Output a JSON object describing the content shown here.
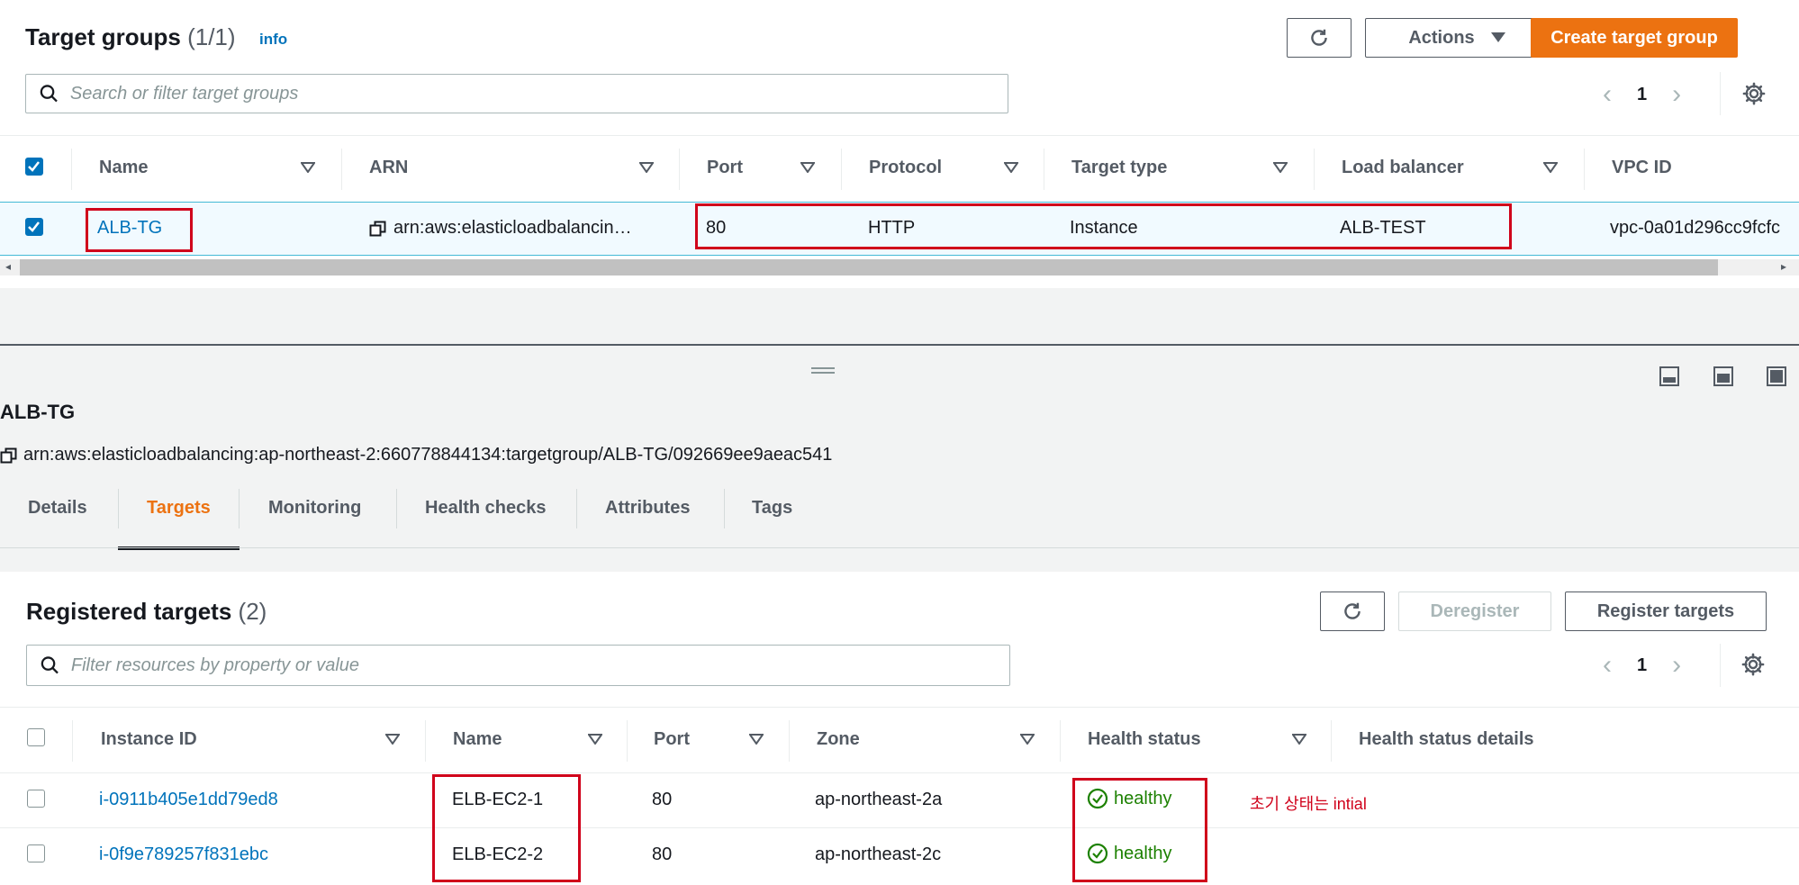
{
  "top": {
    "title": "Target groups",
    "count": "(1/1)",
    "info": "info",
    "actions_label": "Actions",
    "create_label": "Create target group",
    "search_placeholder": "Search or filter target groups",
    "page": "1",
    "columns": [
      "Name",
      "ARN",
      "Port",
      "Protocol",
      "Target type",
      "Load balancer",
      "VPC ID"
    ],
    "row": {
      "name": "ALB-TG",
      "arn": "arn:aws:elasticloadbalancin…",
      "port": "80",
      "protocol": "HTTP",
      "target_type": "Instance",
      "load_balancer": "ALB-TEST",
      "vpc_id": "vpc-0a01d296cc9fcfc"
    }
  },
  "detail": {
    "title": "ALB-TG",
    "arn": "arn:aws:elasticloadbalancing:ap-northeast-2:660778844134:targetgroup/ALB-TG/092669ee9aeac541",
    "tabs": [
      "Details",
      "Targets",
      "Monitoring",
      "Health checks",
      "Attributes",
      "Tags"
    ],
    "active_tab": "Targets"
  },
  "registered": {
    "title": "Registered targets",
    "count": "(2)",
    "deregister_label": "Deregister",
    "register_label": "Register targets",
    "search_placeholder": "Filter resources by property or value",
    "page": "1",
    "columns": [
      "Instance ID",
      "Name",
      "Port",
      "Zone",
      "Health status",
      "Health status details"
    ],
    "rows": [
      {
        "instance_id": "i-0911b405e1dd79ed8",
        "name": "ELB-EC2-1",
        "port": "80",
        "zone": "ap-northeast-2a",
        "health": "healthy"
      },
      {
        "instance_id": "i-0f9e789257f831ebc",
        "name": "ELB-EC2-2",
        "port": "80",
        "zone": "ap-northeast-2c",
        "health": "healthy"
      }
    ],
    "annotation": "초기 상태는 intial"
  },
  "colors": {
    "accent": "#ec7211",
    "link": "#0073bb",
    "healthy": "#1d8102",
    "highlight": "#d0021b"
  }
}
